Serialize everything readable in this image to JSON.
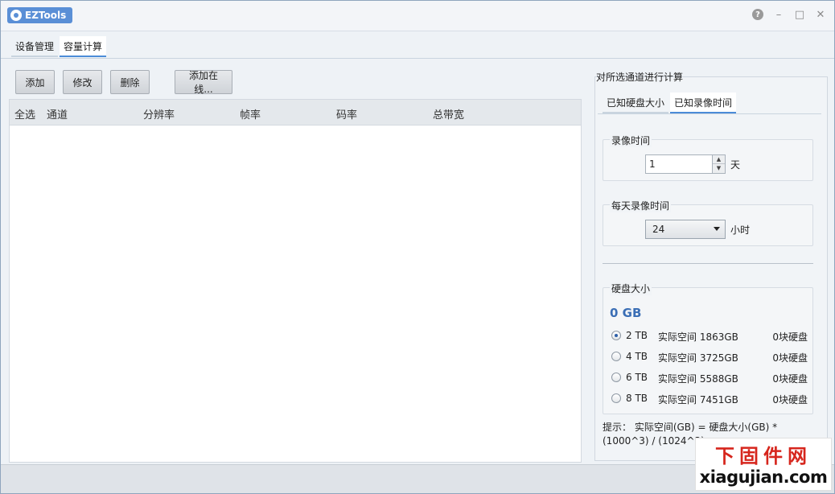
{
  "app": {
    "title": "EZTools",
    "help_icon": "?",
    "minimize_icon": "–",
    "maximize_icon": "□",
    "close_icon": "✕"
  },
  "tabs": [
    {
      "label": "设备管理"
    },
    {
      "label": "容量计算"
    }
  ],
  "toolbar": {
    "add": "添加",
    "modify": "修改",
    "delete": "删除",
    "add_online": "添加在线..."
  },
  "table": {
    "headers": [
      "全选",
      "通道",
      "分辨率",
      "帧率",
      "码率",
      "总带宽"
    ],
    "rows": []
  },
  "right": {
    "title": "对所选通道进行计算",
    "sub_tabs": [
      {
        "label": "已知硬盘大小"
      },
      {
        "label": "已知录像时间"
      }
    ],
    "record_time": {
      "label": "录像时间",
      "value": "1",
      "unit": "天"
    },
    "daily_time": {
      "label": "每天录像时间",
      "value": "24",
      "unit": "小时"
    },
    "disk": {
      "label": "硬盘大小",
      "size": "0 GB",
      "options": [
        {
          "cap": "2 TB",
          "space": "实际空间 1863GB",
          "count": "0块硬盘",
          "checked": true
        },
        {
          "cap": "4 TB",
          "space": "实际空间 3725GB",
          "count": "0块硬盘",
          "checked": false
        },
        {
          "cap": "6 TB",
          "space": "实际空间 5588GB",
          "count": "0块硬盘",
          "checked": false
        },
        {
          "cap": "8 TB",
          "space": "实际空间 7451GB",
          "count": "0块硬盘",
          "checked": false
        }
      ]
    },
    "tip_line1": "提示： 实际空间(GB) = 硬盘大小(GB) *",
    "tip_line2": "(1000^3) / (1024^3)"
  },
  "watermark": {
    "cn": "下固件网",
    "en": "xiagujian.com"
  }
}
